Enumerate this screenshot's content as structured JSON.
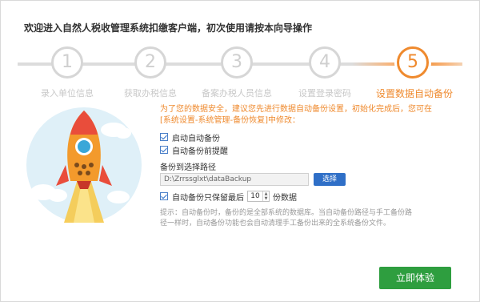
{
  "title": "欢迎进入自然人税收管理系统扣缴客户端，初次使用请按本向导操作",
  "steps": [
    {
      "num": "1",
      "label": "录入单位信息"
    },
    {
      "num": "2",
      "label": "获取办税信息"
    },
    {
      "num": "3",
      "label": "备案办税人员信息"
    },
    {
      "num": "4",
      "label": "设置登录密码"
    },
    {
      "num": "5",
      "label": "设置数据自动备份"
    }
  ],
  "desc": "为了您的数据安全，建议您先进行数据自动备份设置，初始化完成后，您可在[系统设置-系统管理-备份恢复]中修改：",
  "options": {
    "auto_backup": "启动自动备份",
    "remind": "自动备份前提醒"
  },
  "path": {
    "label": "备份到选择路径",
    "value": "D:\\Zrrssglxt\\dataBackup",
    "select_label": "选择"
  },
  "keep": {
    "prefix": "自动备份只保留最后",
    "value": "10",
    "suffix": "份数据"
  },
  "hint": "提示：自动备份时，备份的是全部系统的数据库。当自动备份路径与手工备份路径一样时，自动备份功能也会自动清理手工备份出来的全系统备份文件。",
  "start_button": "立即体验",
  "colors": {
    "accent": "#ef8a2e",
    "primary": "#2f6fc7",
    "success": "#2e9e3f"
  }
}
